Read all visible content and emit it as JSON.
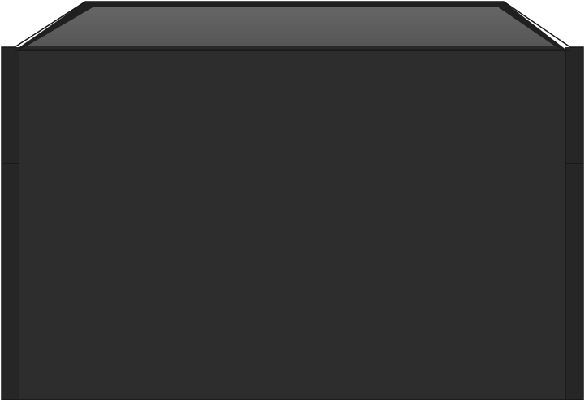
{
  "image": {
    "subject": "",
    "colors": {
      "background": "#ffffff",
      "body": "#2b2b2b",
      "body_edge": "#1c1c1c",
      "side_panel": "#262626",
      "top_frame": "#222222",
      "glass_top": "#5e5e5e",
      "glass_highlight": "#6e6e6e",
      "seam": "#1a1a1a"
    }
  }
}
